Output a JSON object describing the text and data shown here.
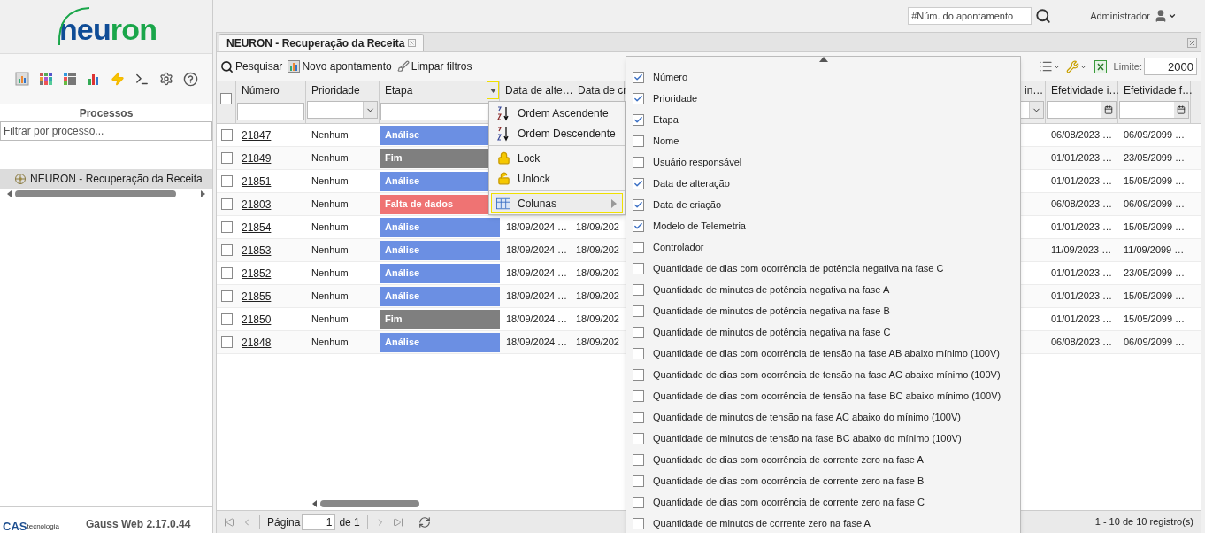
{
  "logo": {
    "primary": "neu",
    "secondary": "ron"
  },
  "sidebar": {
    "title": "Processos",
    "filter_placeholder": "Filtrar por processo...",
    "tree": [
      {
        "label": "NEURON - Recuperação da Receita",
        "selected": true
      }
    ],
    "footer": {
      "company": "CAS",
      "company_sub": "tecnologia",
      "version": "Gauss Web 2.17.0.44"
    }
  },
  "header": {
    "search_placeholder": "#Núm. do apontamento",
    "user": "Administrador"
  },
  "tabs": [
    {
      "label": "NEURON - Recuperação da Receita",
      "selected": true
    }
  ],
  "toolbar": {
    "buttons": [
      {
        "kind": "search",
        "label": "Pesquisar"
      },
      {
        "kind": "new",
        "label": "Novo apontamento"
      },
      {
        "kind": "clear",
        "label": "Limpar filtros"
      }
    ],
    "limit_label": "Limite:",
    "limit_value": "2000"
  },
  "grid": {
    "all_checked": false,
    "columns": [
      {
        "label": "Número",
        "kind": "text",
        "menu_open": false
      },
      {
        "label": "Prioridade",
        "kind": "select",
        "menu_open": false
      },
      {
        "label": "Etapa",
        "kind": "text",
        "menu_open": true
      },
      {
        "label": "Data de alte…",
        "kind": "none",
        "menu_open": false
      },
      {
        "label": "Data de cr",
        "kind": "none",
        "menu_open": false
      },
      {
        "label": "in…",
        "kind": "select",
        "menu_open": false
      },
      {
        "label": "Efetividade i…",
        "kind": "date",
        "menu_open": false
      },
      {
        "label": "Efetividade f…",
        "kind": "date",
        "menu_open": false
      }
    ],
    "rows": [
      {
        "checked": false,
        "number": "21847",
        "priority": "Nenhum",
        "stage": "Análise",
        "color": "#6b8fe3",
        "eff_start": "06/08/2023 …",
        "eff_end": "06/09/2099 …"
      },
      {
        "checked": false,
        "number": "21849",
        "priority": "Nenhum",
        "stage": "Fim",
        "color": "#7f7f7f",
        "eff_start": "01/01/2023 …",
        "eff_end": "23/05/2099 …"
      },
      {
        "checked": false,
        "number": "21851",
        "priority": "Nenhum",
        "stage": "Análise",
        "color": "#6b8fe3",
        "eff_start": "01/01/2023 …",
        "eff_end": "15/05/2099 …"
      },
      {
        "checked": false,
        "number": "21803",
        "priority": "Nenhum",
        "stage": "Falta de dados",
        "color": "#ef7373",
        "eff_start": "06/08/2023 …",
        "eff_end": "06/09/2099 …"
      },
      {
        "checked": false,
        "number": "21854",
        "priority": "Nenhum",
        "stage": "Análise",
        "color": "#6b8fe3",
        "changed": "18/09/2024 …",
        "created": "18/09/202",
        "eff_start": "01/01/2023 …",
        "eff_end": "15/05/2099 …"
      },
      {
        "checked": false,
        "number": "21853",
        "priority": "Nenhum",
        "stage": "Análise",
        "color": "#6b8fe3",
        "changed": "18/09/2024 …",
        "created": "18/09/202",
        "eff_start": "11/09/2023 …",
        "eff_end": "11/09/2099 …"
      },
      {
        "checked": false,
        "number": "21852",
        "priority": "Nenhum",
        "stage": "Análise",
        "color": "#6b8fe3",
        "changed": "18/09/2024 …",
        "created": "18/09/202",
        "eff_start": "01/01/2023 …",
        "eff_end": "23/05/2099 …"
      },
      {
        "checked": false,
        "number": "21855",
        "priority": "Nenhum",
        "stage": "Análise",
        "color": "#6b8fe3",
        "changed": "18/09/2024 …",
        "created": "18/09/202",
        "eff_start": "01/01/2023 …",
        "eff_end": "15/05/2099 …"
      },
      {
        "checked": false,
        "number": "21850",
        "priority": "Nenhum",
        "stage": "Fim",
        "color": "#7f7f7f",
        "changed": "18/09/2024 …",
        "created": "18/09/202",
        "eff_start": "01/01/2023 …",
        "eff_end": "15/05/2099 …"
      },
      {
        "checked": false,
        "number": "21848",
        "priority": "Nenhum",
        "stage": "Análise",
        "color": "#6b8fe3",
        "changed": "18/09/2024 …",
        "created": "18/09/202",
        "eff_start": "06/08/2023 …",
        "eff_end": "06/09/2099 …"
      }
    ]
  },
  "column_menu": {
    "groups": [
      [
        {
          "label": "Ordem Ascendente",
          "selected": false,
          "submenu": false
        },
        {
          "label": "Ordem Descendente",
          "selected": false,
          "submenu": false
        }
      ],
      [
        {
          "label": "Lock",
          "selected": false,
          "submenu": false
        },
        {
          "label": "Unlock",
          "selected": false,
          "submenu": false
        }
      ],
      [
        {
          "label": "Colunas",
          "selected": true,
          "submenu": true
        }
      ]
    ]
  },
  "column_chooser": {
    "items": [
      {
        "label": "Número",
        "checked": true
      },
      {
        "label": "Prioridade",
        "checked": true
      },
      {
        "label": "Etapa",
        "checked": true
      },
      {
        "label": "Nome",
        "checked": false
      },
      {
        "label": "Usuário responsável",
        "checked": false
      },
      {
        "label": "Data de alteração",
        "checked": true
      },
      {
        "label": "Data de criação",
        "checked": true
      },
      {
        "label": "Modelo de Telemetria",
        "checked": true
      },
      {
        "label": "Controlador",
        "checked": false
      },
      {
        "label": "Quantidade de dias com ocorrência de potência negativa na fase C",
        "checked": false
      },
      {
        "label": "Quantidade de minutos de potência negativa na fase A",
        "checked": false
      },
      {
        "label": "Quantidade de minutos de potência negativa na fase B",
        "checked": false
      },
      {
        "label": "Quantidade de minutos de potência negativa na fase C",
        "checked": false
      },
      {
        "label": "Quantidade de dias com ocorrência de tensão na fase AB abaixo mínimo (100V)",
        "checked": false
      },
      {
        "label": "Quantidade de dias com ocorrência de tensão na fase AC abaixo mínimo (100V)",
        "checked": false
      },
      {
        "label": "Quantidade de dias com ocorrência de tensão na fase BC abaixo mínimo (100V)",
        "checked": false
      },
      {
        "label": "Quantidade de minutos de tensão na fase AC abaixo do mínimo (100V)",
        "checked": false
      },
      {
        "label": "Quantidade de minutos de tensão na fase BC abaixo do mínimo (100V)",
        "checked": false
      },
      {
        "label": "Quantidade de dias com ocorrência de corrente zero na fase A",
        "checked": false
      },
      {
        "label": "Quantidade de dias com ocorrência de corrente zero na fase B",
        "checked": false
      },
      {
        "label": "Quantidade de dias com ocorrência de corrente zero na fase C",
        "checked": false
      },
      {
        "label": "Quantidade de minutos de corrente zero na fase A",
        "checked": false
      }
    ]
  },
  "pager": {
    "page_label": "Página",
    "page": "1",
    "of": "de 1",
    "summary": "1 - 10 de 10 registro(s)"
  }
}
